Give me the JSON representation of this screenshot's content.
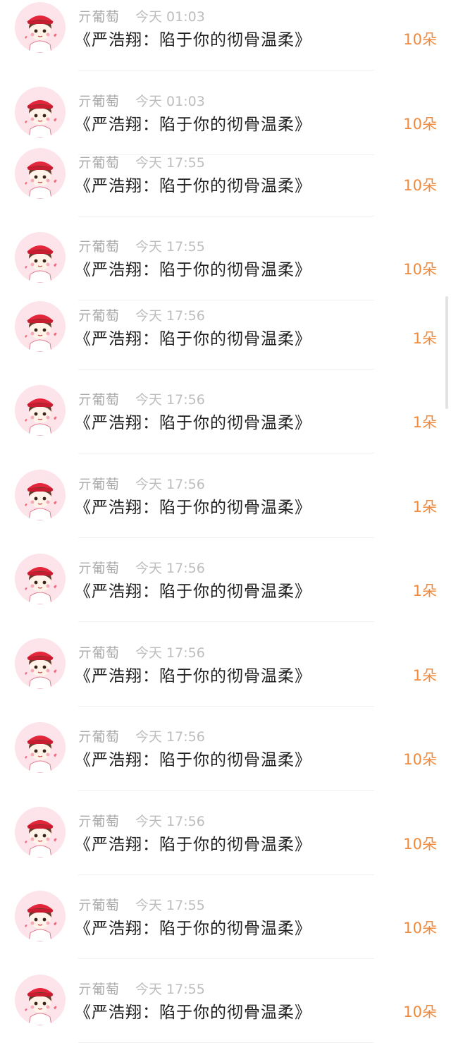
{
  "colors": {
    "accent": "#f08a3c",
    "avatar_bg": "#fde4ea"
  },
  "items": [
    {
      "avatar": "chibi-avatar",
      "name": "亓葡萄",
      "time": "今天 01:03",
      "title": "《严浩翔：陷于你的彻骨温柔》",
      "amount": "10朵"
    },
    {
      "avatar": "chibi-avatar",
      "name": "亓葡萄",
      "time": "今天 01:03",
      "title": "《严浩翔：陷于你的彻骨温柔》",
      "amount": "10朵"
    },
    {
      "avatar": "chibi-avatar",
      "name": "亓葡萄",
      "time": "今天 17:55",
      "title": "《严浩翔：陷于你的彻骨温柔》",
      "amount": "10朵"
    },
    {
      "avatar": "chibi-avatar",
      "name": "亓葡萄",
      "time": "今天 17:55",
      "title": "《严浩翔：陷于你的彻骨温柔》",
      "amount": "10朵"
    },
    {
      "avatar": "chibi-avatar",
      "name": "亓葡萄",
      "time": "今天 17:56",
      "title": "《严浩翔：陷于你的彻骨温柔》",
      "amount": "1朵"
    },
    {
      "avatar": "chibi-avatar",
      "name": "亓葡萄",
      "time": "今天 17:56",
      "title": "《严浩翔：陷于你的彻骨温柔》",
      "amount": "1朵"
    },
    {
      "avatar": "chibi-avatar",
      "name": "亓葡萄",
      "time": "今天 17:56",
      "title": "《严浩翔：陷于你的彻骨温柔》",
      "amount": "1朵"
    },
    {
      "avatar": "chibi-avatar",
      "name": "亓葡萄",
      "time": "今天 17:56",
      "title": "《严浩翔：陷于你的彻骨温柔》",
      "amount": "1朵"
    },
    {
      "avatar": "chibi-avatar",
      "name": "亓葡萄",
      "time": "今天 17:56",
      "title": "《严浩翔：陷于你的彻骨温柔》",
      "amount": "1朵"
    },
    {
      "avatar": "chibi-avatar",
      "name": "亓葡萄",
      "time": "今天 17:56",
      "title": "《严浩翔：陷于你的彻骨温柔》",
      "amount": "10朵"
    },
    {
      "avatar": "chibi-avatar",
      "name": "亓葡萄",
      "time": "今天 17:56",
      "title": "《严浩翔：陷于你的彻骨温柔》",
      "amount": "10朵"
    },
    {
      "avatar": "chibi-avatar",
      "name": "亓葡萄",
      "time": "今天 17:55",
      "title": "《严浩翔：陷于你的彻骨温柔》",
      "amount": "10朵"
    },
    {
      "avatar": "chibi-avatar",
      "name": "亓葡萄",
      "time": "今天 17:55",
      "title": "《严浩翔：陷于你的彻骨温柔》",
      "amount": "10朵"
    }
  ]
}
